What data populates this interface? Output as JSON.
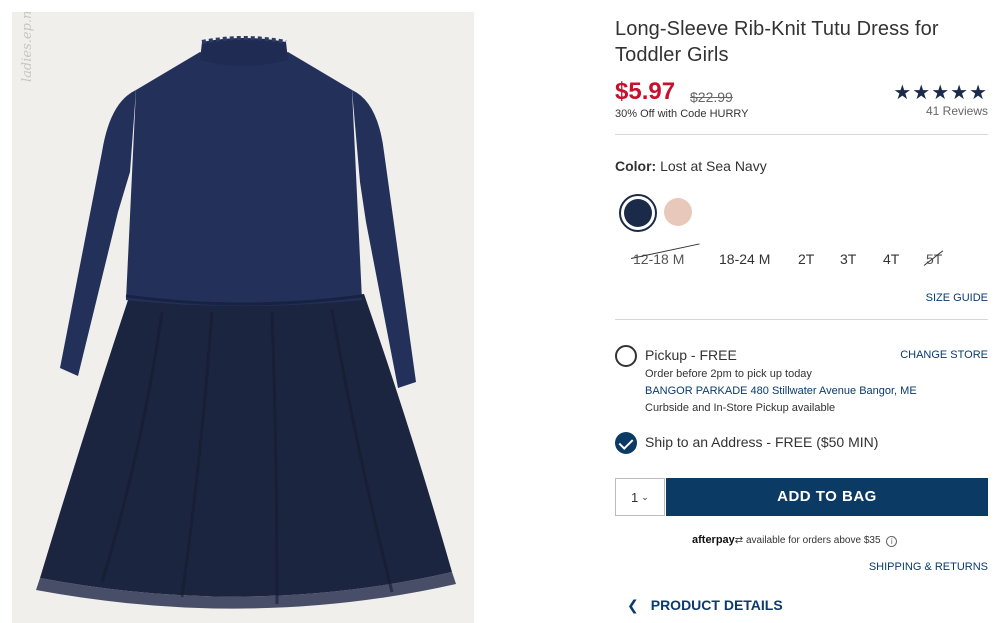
{
  "product": {
    "title": "Long-Sleeve Rib-Knit Tutu Dress for Toddler Girls",
    "price": "$5.97",
    "original_price": "$22.99",
    "promo": "30% Off with Code HURRY",
    "stars": "★★★★★",
    "reviews": "41 Reviews",
    "watermark": "ladies.ep.ng"
  },
  "color": {
    "label": "Color:",
    "value": "Lost at Sea Navy",
    "swatches": [
      {
        "name": "Lost at Sea Navy",
        "hex": "#1b2a48",
        "selected": true
      },
      {
        "name": "Pink",
        "hex": "#e8c8b8",
        "selected": false
      }
    ]
  },
  "sizes": [
    {
      "label": "12-18 M",
      "available": false
    },
    {
      "label": "18-24 M",
      "available": true
    },
    {
      "label": "2T",
      "available": true
    },
    {
      "label": "3T",
      "available": true
    },
    {
      "label": "4T",
      "available": true
    },
    {
      "label": "5T",
      "available": false
    }
  ],
  "size_guide": "SIZE GUIDE",
  "fulfillment": {
    "pickup_title": "Pickup - FREE",
    "change_store": "CHANGE STORE",
    "pickup_note": "Order before 2pm to pick up today",
    "store": "BANGOR PARKADE 480 Stillwater Avenue  Bangor, ME",
    "pickup_options": "Curbside and In-Store Pickup available",
    "ship_title": "Ship to an Address - FREE ($50 MIN)"
  },
  "cart": {
    "quantity": "1",
    "add_to_bag": "ADD TO BAG"
  },
  "afterpay": {
    "brand": "afterpay",
    "text": "available for orders above $35"
  },
  "links": {
    "shipping_returns": "SHIPPING & RETURNS",
    "product_details": "PRODUCT DETAILS"
  },
  "colors": {
    "price_red": "#c8102e",
    "brand_navy": "#0b3a64",
    "link_blue": "#0a3a6e"
  }
}
